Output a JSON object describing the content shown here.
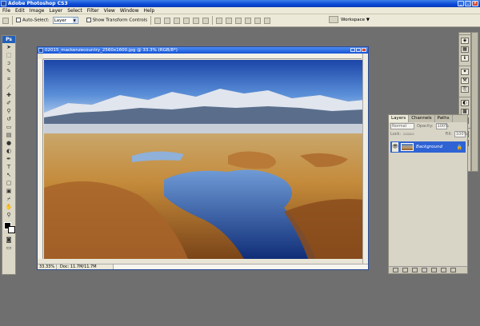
{
  "app": {
    "title": "Adobe Photoshop CS3"
  },
  "menu": [
    "File",
    "Edit",
    "Image",
    "Layer",
    "Select",
    "Filter",
    "View",
    "Window",
    "Help"
  ],
  "options": {
    "auto_select_label": "Auto-Select:",
    "auto_select_value": "Layer",
    "transform_label": "Show Transform Controls",
    "workspace_label": "Workspace"
  },
  "toolbox": {
    "logo": "Ps"
  },
  "document": {
    "title": "02015_mackenzecountry_2560x1600.jpg @ 33.3% (RGB/8*)",
    "zoom": "33.33%",
    "doc_info": "Doc: 11.7M/11.7M"
  },
  "layers_panel": {
    "tabs": [
      "Layers",
      "Channels",
      "Paths"
    ],
    "blend_mode": "Normal",
    "opacity_label": "Opacity:",
    "opacity_value": "100%",
    "lock_label": "Lock:",
    "fill_label": "Fill:",
    "fill_value": "100%",
    "layer_name": "Background",
    "footer_icons": [
      "link-icon",
      "fx-icon",
      "mask-icon",
      "adjustment-icon",
      "group-icon",
      "new-layer-icon",
      "trash-icon"
    ]
  }
}
